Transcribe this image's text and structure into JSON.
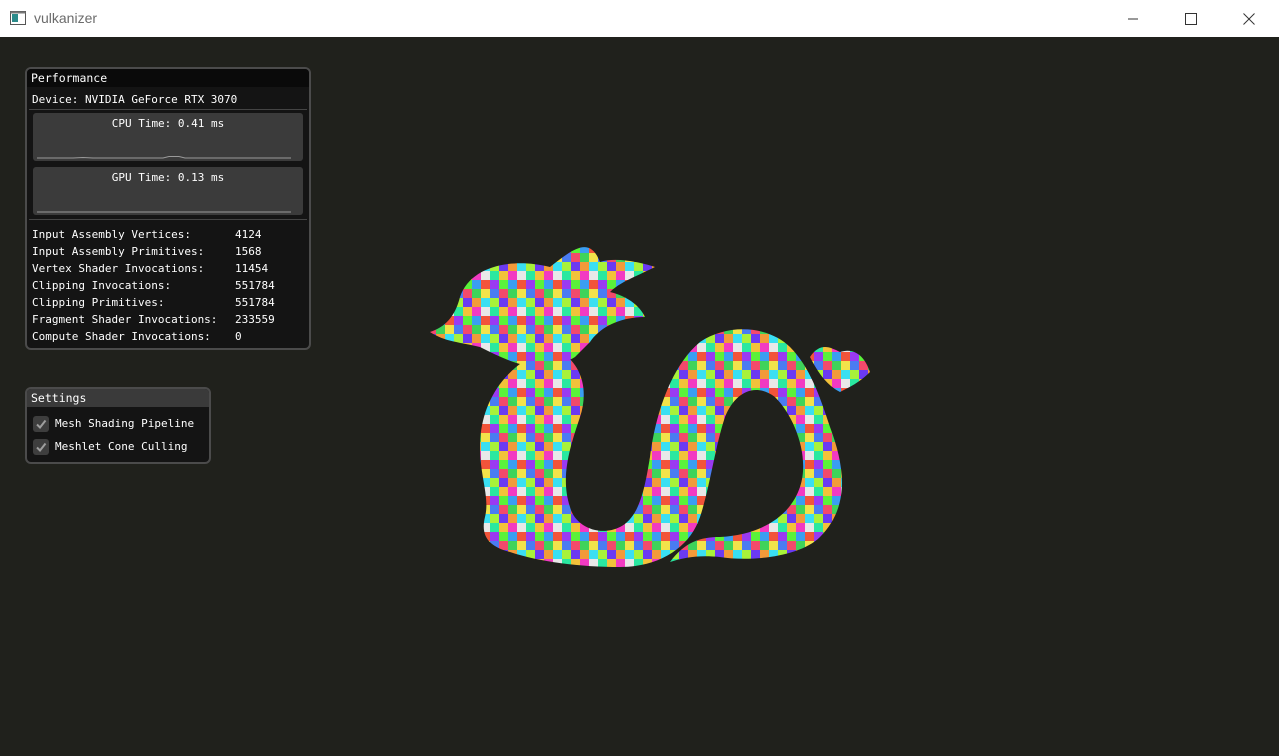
{
  "window": {
    "title": "vulkanizer",
    "icon": "app-window-icon",
    "controls": [
      "minimize-icon",
      "maximize-icon",
      "close-icon"
    ]
  },
  "performance": {
    "title": "Performance",
    "device": "Device: NVIDIA GeForce RTX 3070",
    "cpu_plot_label": "CPU Time: 0.41 ms",
    "gpu_plot_label": "GPU Time: 0.13 ms",
    "stats": [
      {
        "label": "Input Assembly Vertices:",
        "value": "4124"
      },
      {
        "label": "Input Assembly Primitives:",
        "value": "1568"
      },
      {
        "label": "Vertex Shader Invocations:",
        "value": "11454"
      },
      {
        "label": "Clipping Invocations:",
        "value": "551784"
      },
      {
        "label": "Clipping Primitives:",
        "value": "551784"
      },
      {
        "label": "Fragment Shader Invocations:",
        "value": "233559"
      },
      {
        "label": "Compute Shader Invocations:",
        "value": "0"
      }
    ]
  },
  "settings": {
    "title": "Settings",
    "options": [
      {
        "label": "Mesh Shading Pipeline",
        "checked": true
      },
      {
        "label": "Meshlet Cone Culling",
        "checked": true
      }
    ]
  },
  "colors": {
    "background": "#20211c",
    "panel": "#141414",
    "plot": "#3b3b3b"
  }
}
